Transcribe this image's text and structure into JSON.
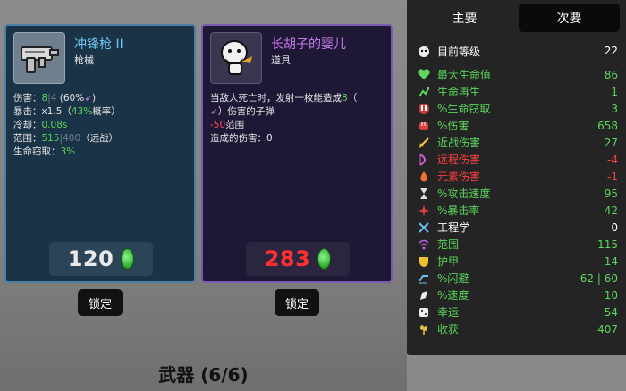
{
  "weapon_card": {
    "name": "冲锋枪 II",
    "type": "枪械",
    "stats": {
      "damage_label": "伤害：",
      "damage_value": "8",
      "damage_sep": "|",
      "damage_base": "4",
      "damage_scaling": "(60%",
      "damage_scaling_end": ")",
      "crit_label": "暴击：x1.5（",
      "crit_value": "43%",
      "crit_suffix": "概率）",
      "cooldown_label": "冷却：",
      "cooldown_value": "0.08s",
      "range_label": "范围：",
      "range_value": "515",
      "range_sep": "|",
      "range_base": "400",
      "range_suffix": "（远战）",
      "lifesteal_label": "生命窃取：",
      "lifesteal_value": "3%"
    },
    "price": "120",
    "lock_label": "锁定"
  },
  "item_card": {
    "name": "长胡子的婴儿",
    "type": "道具",
    "desc_line1": "当敌人死亡时，发射一枚能造成",
    "desc_value": "8",
    "desc_line1_end": "（",
    "desc_line2": "）伤害的子弹",
    "range_penalty": "-50",
    "range_label": "范围",
    "dealt_label": "造成的伤害：0",
    "price": "283",
    "lock_label": "锁定"
  },
  "footer": {
    "title": "武器 (6/6)"
  },
  "panel": {
    "tabs": [
      {
        "label": "主要"
      },
      {
        "label": "次要"
      }
    ],
    "level": {
      "label": "目前等级",
      "value": "22"
    },
    "stats": [
      {
        "label": "最大生命值",
        "value": "86",
        "color": "#5cd65c",
        "icon": "heart-icon"
      },
      {
        "label": "生命再生",
        "value": "1",
        "color": "#5cd65c",
        "icon": "regen-icon"
      },
      {
        "label": "%生命窃取",
        "value": "3",
        "color": "#5cd65c",
        "icon": "lifesteal-icon"
      },
      {
        "label": "%伤害",
        "value": "658",
        "color": "#5cd65c",
        "icon": "fist-icon"
      },
      {
        "label": "近战伤害",
        "value": "27",
        "color": "#5cd65c",
        "icon": "sword-icon"
      },
      {
        "label": "远程伤害",
        "value": "-4",
        "color": "#ff4040",
        "icon": "bow-icon"
      },
      {
        "label": "元素伤害",
        "value": "-1",
        "color": "#ff4040",
        "icon": "flame-icon"
      },
      {
        "label": "%攻击速度",
        "value": "95",
        "color": "#5cd65c",
        "icon": "hourglass-icon"
      },
      {
        "label": "%暴击率",
        "value": "42",
        "color": "#5cd65c",
        "icon": "crit-icon"
      },
      {
        "label": "工程学",
        "value": "0",
        "color": "#ffffff",
        "icon": "wrench-icon"
      },
      {
        "label": "范围",
        "value": "115",
        "color": "#5cd65c",
        "icon": "range-icon"
      },
      {
        "label": "护甲",
        "value": "14",
        "color": "#5cd65c",
        "icon": "shield-icon"
      },
      {
        "label": "%闪避",
        "value": "62 | 60",
        "color": "#5cd65c",
        "icon": "dodge-icon"
      },
      {
        "label": "%速度",
        "value": "10",
        "color": "#5cd65c",
        "icon": "speed-icon"
      },
      {
        "label": "幸运",
        "value": "54",
        "color": "#5cd65c",
        "icon": "luck-icon"
      },
      {
        "label": "收获",
        "value": "407",
        "color": "#5cd65c",
        "icon": "harvest-icon"
      }
    ]
  }
}
